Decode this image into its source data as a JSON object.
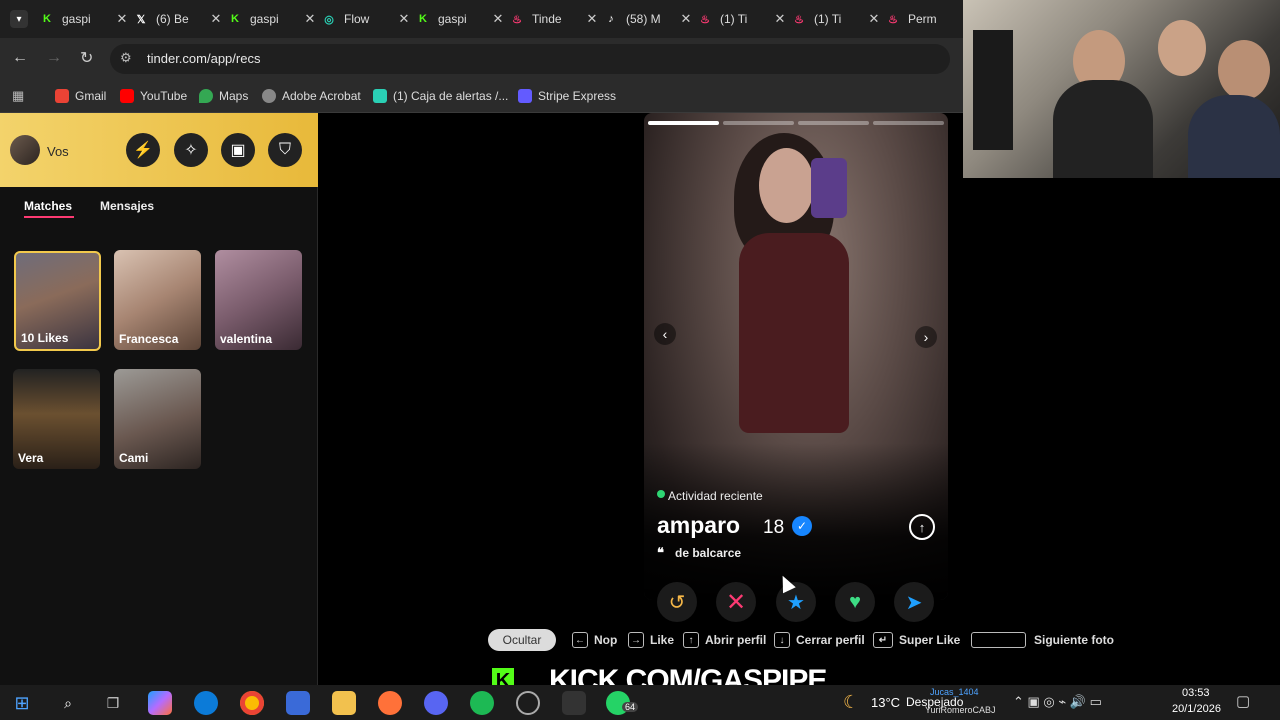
{
  "tabs": [
    {
      "title": "gaspi",
      "icon": "kick-icon",
      "color": "#53fc18"
    },
    {
      "title": "(6) Be",
      "icon": "x-icon",
      "color": "#ffffff"
    },
    {
      "title": "gaspi",
      "icon": "kick-icon",
      "color": "#53fc18"
    },
    {
      "title": "Flow",
      "icon": "flow-icon",
      "color": "#2ad0b5"
    },
    {
      "title": "gaspi",
      "icon": "kick-icon",
      "color": "#53fc18"
    },
    {
      "title": "Tinde",
      "icon": "tinder-icon",
      "color": "#fd3a73"
    },
    {
      "title": "(58) M",
      "icon": "tiktok-icon",
      "color": "#ffffff"
    },
    {
      "title": "(1) Ti",
      "icon": "tinder-icon",
      "color": "#fd3a73"
    },
    {
      "title": "(1) Ti",
      "icon": "tinder-icon",
      "color": "#fd3a73"
    },
    {
      "title": "Perm",
      "icon": "tinder-icon",
      "color": "#fd3a73"
    }
  ],
  "address": {
    "url": "tinder.com/app/recs"
  },
  "bookmarks": [
    "Gmail",
    "YouTube",
    "Maps",
    "Adobe Acrobat",
    "(1) Caja de alertas /...",
    "Stripe Express"
  ],
  "sidebar": {
    "user_label": "Vos",
    "tabs": {
      "matches": "Matches",
      "messages": "Mensajes"
    },
    "cards": [
      {
        "label": "10 Likes"
      },
      {
        "label": "Francesca"
      },
      {
        "label": "valentina"
      },
      {
        "label": "Vera"
      },
      {
        "label": "Cami"
      }
    ]
  },
  "profile": {
    "activity": "Actividad reciente",
    "name": "amparo",
    "age": "18",
    "bio": "de balcarce"
  },
  "shortcuts": {
    "hide": "Ocultar",
    "nope": "Nop",
    "like": "Like",
    "open": "Abrir perfil",
    "close": "Cerrar perfil",
    "super": "Super Like",
    "next": "Siguiente foto"
  },
  "overlay": {
    "banner": "KICK.COM/GASPIPE"
  },
  "taskbar": {
    "weather": "13°C",
    "weather_desc": "Despejado",
    "time": "03:53",
    "date": "20/1/2026",
    "badge": "64",
    "chat1": "Jucas_1404",
    "chat2": "YuriRomeroCABJ"
  },
  "colors": {
    "accent": "#f2c94c",
    "tinder": "#fd3a73",
    "kick": "#53fc18"
  }
}
